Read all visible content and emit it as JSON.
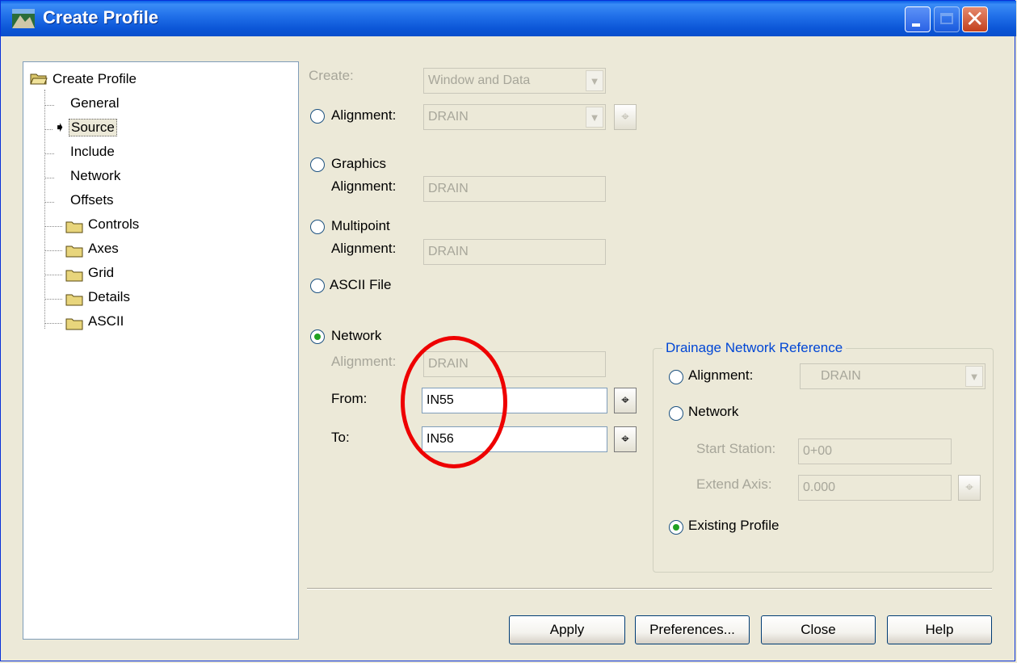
{
  "window": {
    "title": "Create Profile"
  },
  "tree": {
    "root": "Create Profile",
    "children": [
      "General",
      "Source",
      "Include",
      "Network",
      "Offsets"
    ],
    "folders": [
      "Controls",
      "Axes",
      "Grid",
      "Details",
      "ASCII"
    ],
    "selected": "Source"
  },
  "form": {
    "create_label": "Create:",
    "create_value": "Window and Data",
    "alignment_label": "Alignment:",
    "alignment_value": "DRAIN",
    "graphics_label": "Graphics",
    "graphics_alignment_label": "Alignment:",
    "graphics_alignment_value": "DRAIN",
    "multipoint_label": "Multipoint",
    "multipoint_alignment_label": "Alignment:",
    "multipoint_alignment_value": "DRAIN",
    "ascii_label": "ASCII File",
    "network_label": "Network",
    "network_alignment_label": "Alignment:",
    "network_alignment_value": "DRAIN",
    "from_label": "From:",
    "from_value": "IN55",
    "to_label": "To:",
    "to_value": "IN56",
    "selected_source": "Network"
  },
  "drainage": {
    "title": "Drainage Network Reference",
    "alignment_label": "Alignment:",
    "alignment_value": "DRAIN",
    "network_label": "Network",
    "start_station_label": "Start Station:",
    "start_station_value": "0+00",
    "extend_axis_label": "Extend Axis:",
    "extend_axis_value": "0.000",
    "existing_profile_label": "Existing Profile",
    "selected": "Existing Profile"
  },
  "buttons": {
    "apply": "Apply",
    "preferences": "Preferences...",
    "close": "Close",
    "help": "Help"
  },
  "icons": {
    "pick": "crosshair-icon",
    "arrow": "arrow-right-icon",
    "folder": "folder-icon"
  },
  "colors": {
    "accent": "#0046d5",
    "highlight": "#ee0000",
    "titlebar": "#0a5fe8"
  }
}
